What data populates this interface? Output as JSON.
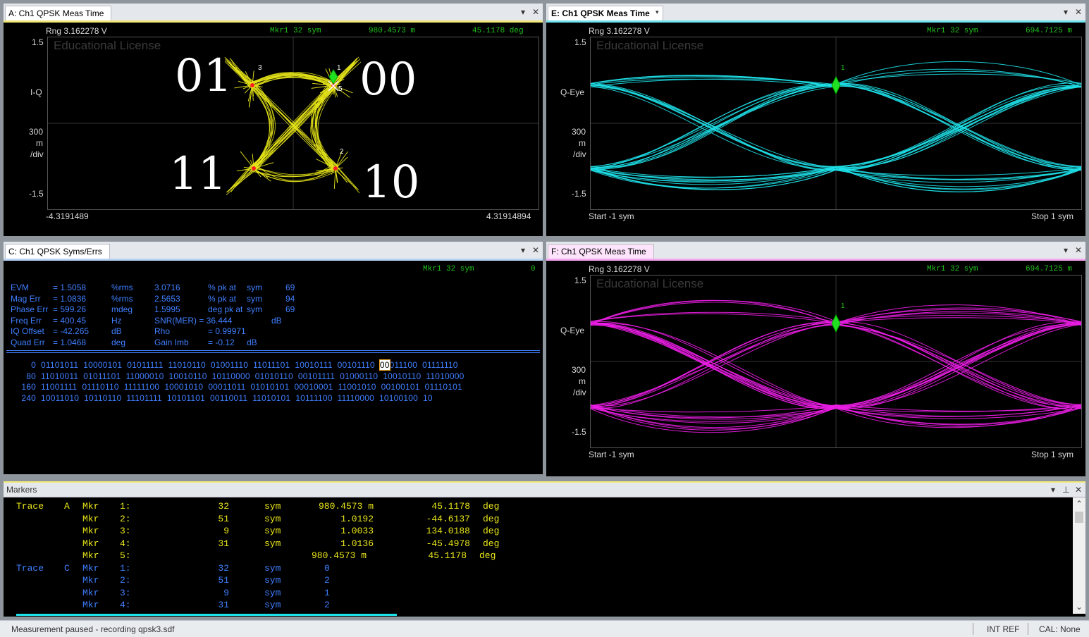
{
  "panelA": {
    "tab": "A: Ch1 QPSK Meas Time",
    "rng": "Rng 3.162278  V",
    "mkr": "Mkr1   32  sym",
    "val1": "980.4573  m",
    "val2": "45.1178   deg",
    "watermark": "Educational License",
    "y_top": "1.5",
    "y_name": "I-Q",
    "y_div1": "300",
    "y_div2": "m",
    "y_div3": "/div",
    "y_bot": "-1.5",
    "x_left": "-4.3191489",
    "x_right": "4.31914894",
    "sym_01": "01",
    "sym_00": "00",
    "sym_11": "11",
    "sym_10": "10",
    "mk1": "1",
    "mk2": "2",
    "mk3": "3",
    "mk5": "5",
    "trace_color": "#e8e619"
  },
  "panelE": {
    "tab": "E: Ch1 QPSK Meas Time",
    "rng": "Rng 3.162278  V",
    "mkr": "Mkr1   32  sym",
    "val": "694.7125  m",
    "watermark": "Educational License",
    "y_top": "1.5",
    "y_name": "Q-Eye",
    "y_div1": "300",
    "y_div2": "m",
    "y_div3": "/div",
    "y_bot": "-1.5",
    "x_left": "Start -1  sym",
    "x_right": "Stop 1  sym",
    "mk1": "1",
    "trace_color": "#1ee0e8"
  },
  "panelF": {
    "tab": "F: Ch1 QPSK Meas Time",
    "rng": "Rng 3.162278  V",
    "mkr": "Mkr1   32  sym",
    "val": "694.7125  m",
    "watermark": "Educational License",
    "y_top": "1.5",
    "y_name": "Q-Eye",
    "y_div1": "300",
    "y_div2": "m",
    "y_div3": "/div",
    "y_bot": "-1.5",
    "x_left": "Start -1  sym",
    "x_right": "Stop 1  sym",
    "mk1": "1",
    "trace_color": "#ee1ee8"
  },
  "panelC": {
    "tab": "C: Ch1 QPSK Syms/Errs",
    "mkr": "Mkr1   32  sym",
    "mkr_val": "0",
    "metrics": [
      {
        "name": "EVM",
        "eq": "= 1.5058",
        "unit": "%rms",
        "v2": "3.0716",
        "u2": "% pk  at",
        "at": "sym",
        "n": "69"
      },
      {
        "name": "Mag Err",
        "eq": "= 1.0836",
        "unit": "%rms",
        "v2": "2.5653",
        "u2": "% pk  at",
        "at": "sym",
        "n": "94"
      },
      {
        "name": "Phase Err",
        "eq": "= 599.26",
        "unit": "mdeg",
        "v2": "1.5995",
        "u2": "deg  pk  at",
        "at": "sym",
        "n": "69"
      },
      {
        "name": "Freq Err",
        "eq": "= 400.45",
        "unit": "Hz",
        "v2": "SNR(MER) =  36.444",
        "u2": "",
        "at": "dB",
        "n": ""
      },
      {
        "name": "IQ Offset",
        "eq": "= -42.265",
        "unit": "dB",
        "v2": "Rho",
        "u2": "= 0.99971",
        "at": "",
        "n": ""
      },
      {
        "name": "Quad Err",
        "eq": "= 1.0468",
        "unit": "deg",
        "v2": "Gain  Imb",
        "u2": "= -0.12",
        "at": "dB",
        "n": ""
      }
    ],
    "rows": [
      {
        "idx": "0",
        "bits": [
          "01101011",
          "10000101",
          "01011111",
          "11010110",
          "01001110",
          "11011101",
          "10010111",
          "00101110"
        ],
        "hl": "00",
        "tail": "011100  01111110"
      },
      {
        "idx": "80",
        "bits": [
          "11010011",
          "01011101",
          "11000010",
          "10010110",
          "10110000",
          "01010110",
          "00101111",
          "01000110",
          "10010110",
          "11010000"
        ],
        "hl": "",
        "tail": ""
      },
      {
        "idx": "160",
        "bits": [
          "11001111",
          "01110110",
          "11111100",
          "10001010",
          "00011011",
          "01010101",
          "00010001",
          "11001010",
          "00100101",
          "01110101"
        ],
        "hl": "",
        "tail": ""
      },
      {
        "idx": "240",
        "bits": [
          "10011010",
          "10110110",
          "11101111",
          "10101101",
          "00110011",
          "11010101",
          "10111100",
          "11110000",
          "10100100",
          "10"
        ],
        "hl": "",
        "tail": ""
      }
    ]
  },
  "markers": {
    "title": "Markers",
    "traceA": [
      {
        "trace": "Trace",
        "id": "A",
        "mkr": "Mkr",
        "n": "1:",
        "v": "32",
        "u": "sym",
        "a": "980.4573 m",
        "b": "45.1178",
        "bu": "deg"
      },
      {
        "trace": "",
        "id": "",
        "mkr": "Mkr",
        "n": "2:",
        "v": "51",
        "u": "sym",
        "a": "1.0192",
        "b": "-44.6137",
        "bu": "deg"
      },
      {
        "trace": "",
        "id": "",
        "mkr": "Mkr",
        "n": "3:",
        "v": "9",
        "u": "sym",
        "a": "1.0033",
        "b": "134.0188",
        "bu": "deg"
      },
      {
        "trace": "",
        "id": "",
        "mkr": "Mkr",
        "n": "4:",
        "v": "31",
        "u": "sym",
        "a": "1.0136",
        "b": "-45.4978",
        "bu": "deg"
      },
      {
        "trace": "",
        "id": "",
        "mkr": "Mkr",
        "n": "5:",
        "v": "",
        "u": "",
        "a": "980.4573 m",
        "b": "45.1178",
        "bu": "deg"
      }
    ],
    "traceC": [
      {
        "trace": "Trace",
        "id": "C",
        "mkr": "Mkr",
        "n": "1:",
        "v": "32",
        "u": "sym",
        "a": "0"
      },
      {
        "trace": "",
        "id": "",
        "mkr": "Mkr",
        "n": "2:",
        "v": "51",
        "u": "sym",
        "a": "2"
      },
      {
        "trace": "",
        "id": "",
        "mkr": "Mkr",
        "n": "3:",
        "v": "9",
        "u": "sym",
        "a": "1"
      },
      {
        "trace": "",
        "id": "",
        "mkr": "Mkr",
        "n": "4:",
        "v": "31",
        "u": "sym",
        "a": "2"
      }
    ]
  },
  "status": {
    "message": "Measurement paused - recording qpsk3.sdf",
    "ref": "INT REF",
    "cal": "CAL: None"
  },
  "icons": {
    "dropdown": "▾",
    "close": "✕",
    "pin": "⊥",
    "up": "⌃",
    "down": "⌄"
  }
}
